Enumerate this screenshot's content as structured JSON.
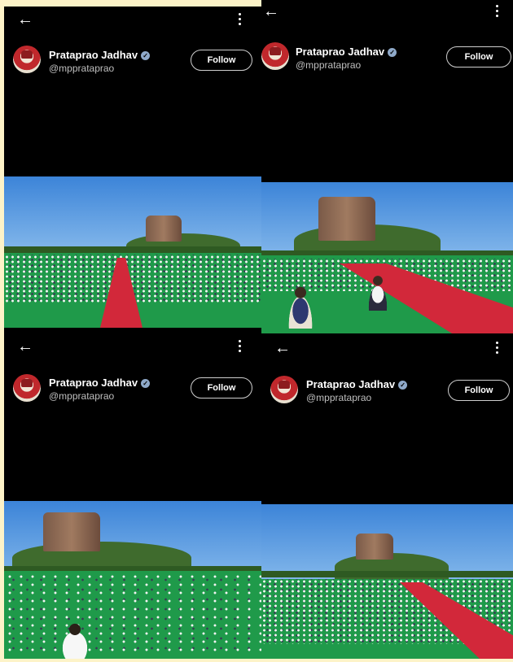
{
  "profile": {
    "name": "Prataprao Jadhav",
    "handle": "@mpprataprao",
    "follow_label": "Follow"
  },
  "icons": {
    "back": "back-arrow-icon",
    "more": "more-vertical-icon",
    "verified": "verified-badge-icon",
    "back_glyph": "←"
  },
  "colors": {
    "background": "#fdf3c8",
    "panel": "#000000",
    "field_green": "#1f9a4a",
    "carpet_red": "#d2283a",
    "sky_blue": "#3c84d8"
  }
}
